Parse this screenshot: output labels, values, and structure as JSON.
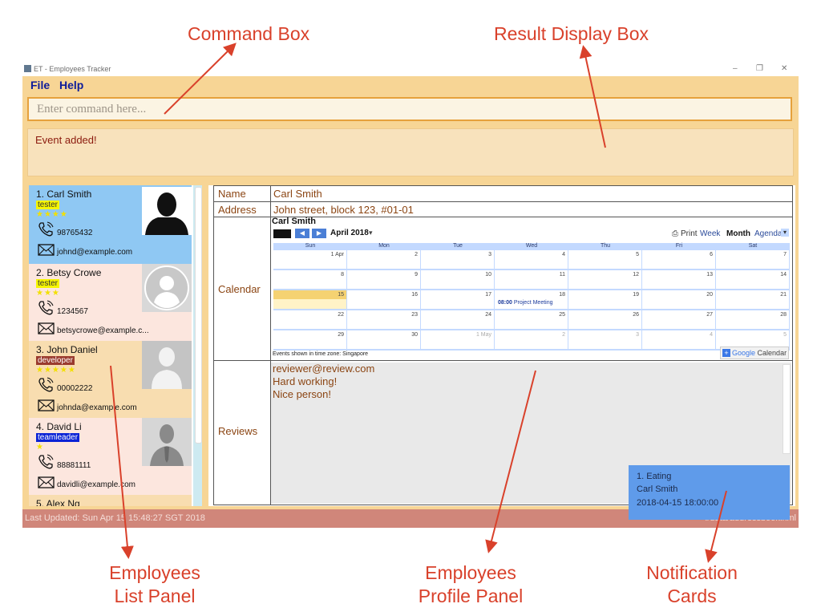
{
  "callouts": {
    "command_box": "Command Box",
    "result_display_box": "Result Display Box",
    "list_line1": "Employees",
    "list_line2": "List Panel",
    "profile_line1": "Employees",
    "profile_line2": "Profile Panel",
    "notif_line1": "Notification",
    "notif_line2": "Cards"
  },
  "window": {
    "title": "ET - Employees Tracker",
    "controls": {
      "minimize": "–",
      "restore": "❐",
      "close": "✕"
    }
  },
  "menu": {
    "file": "File",
    "help": "Help"
  },
  "command": {
    "placeholder": "Enter command here...",
    "value": ""
  },
  "result": {
    "text": "Event added!"
  },
  "employees": [
    {
      "index_name": "1.  Carl Smith",
      "tag": "tester",
      "tag_color": "#f5f500",
      "stars": "★★★★",
      "phone": "98765432",
      "email": "johnd@example.com",
      "bg": "#8fc8f3"
    },
    {
      "index_name": "2.  Betsy Crowe",
      "tag": "tester",
      "tag_color": "#f5f500",
      "stars": "★★★",
      "phone": "1234567",
      "email": "betsycrowe@example.c...",
      "bg": "#fce6de"
    },
    {
      "index_name": "3.  John Daniel",
      "tag": "developer",
      "tag_color": "#9a3b2e",
      "stars": "★★★★★",
      "phone": "00002222",
      "email": "johnda@example.com",
      "bg": "#f8ddb0"
    },
    {
      "index_name": "4.  David Li",
      "tag": "teamleader",
      "tag_color": "#0a22d6",
      "stars": "★",
      "phone": "88881111",
      "email": "davidli@example.com",
      "bg": "#fce6de"
    },
    {
      "index_name": "5.  Alex Ng",
      "bg": "#f8ddb0"
    }
  ],
  "profile": {
    "name_label": "Name",
    "name": "Carl Smith",
    "address_label": "Address",
    "address": "John street, block 123, #01-01",
    "calendar_label": "Calendar",
    "reviews_label": "Reviews",
    "reviews": [
      "reviewer@review.com",
      "Hard working!",
      "Nice person!"
    ]
  },
  "calendar": {
    "title": "Carl Smith",
    "month": "April 2018",
    "print": "Print",
    "views": [
      "Week",
      "Month",
      "Agenda"
    ],
    "active_view": "Month",
    "days": [
      "Sun",
      "Mon",
      "Tue",
      "Wed",
      "Thu",
      "Fri",
      "Sat"
    ],
    "weeks": [
      [
        "1 Apr",
        "2",
        "3",
        "4",
        "5",
        "6",
        "7"
      ],
      [
        "8",
        "9",
        "10",
        "11",
        "12",
        "13",
        "14"
      ],
      [
        "15",
        "16",
        "17",
        "18",
        "19",
        "20",
        "21"
      ],
      [
        "22",
        "23",
        "24",
        "25",
        "26",
        "27",
        "28"
      ],
      [
        "29",
        "30",
        "1 May",
        "2",
        "3",
        "4",
        "5"
      ]
    ],
    "event_time": "08:00",
    "event_title": "Project Meeting",
    "timezone": "Events shown in time zone: Singapore",
    "brand_google": "Google",
    "brand_calendar": "Calendar"
  },
  "status": {
    "last_updated": "Last Updated: Sun Apr 15 15:48:27 SGT 2018",
    "file": "./data/addressbook.xml"
  },
  "notification": {
    "title": "1.  Eating",
    "person": "Carl Smith",
    "datetime": "2018-04-15 18:00:00"
  }
}
